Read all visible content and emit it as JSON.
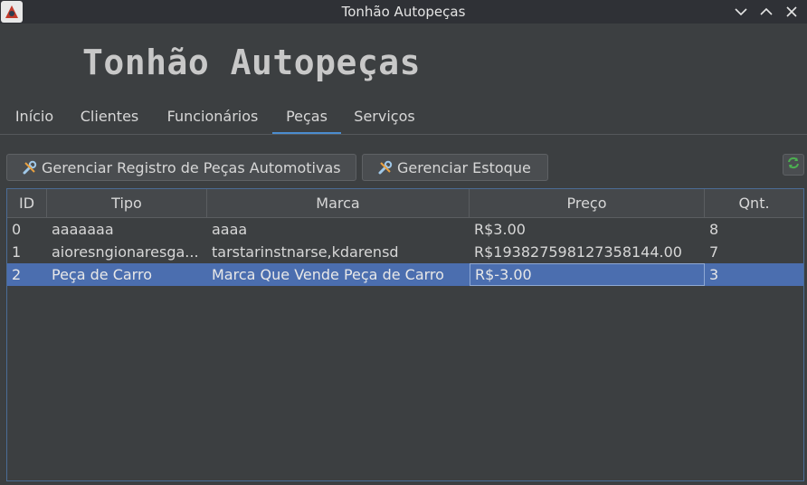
{
  "window": {
    "title": "Tonhão Autopeças"
  },
  "header": {
    "title": "Tonhão Autopeças"
  },
  "tabs": [
    {
      "label": "Início"
    },
    {
      "label": "Clientes"
    },
    {
      "label": "Funcionários"
    },
    {
      "label": "Peças",
      "active": true
    },
    {
      "label": "Serviços"
    }
  ],
  "toolbar": {
    "manage_registry_label": "Gerenciar Registro de Peças Automotivas",
    "manage_stock_label": "Gerenciar Estoque"
  },
  "table": {
    "columns": [
      "ID",
      "Tipo",
      "Marca",
      "Preço",
      "Qnt."
    ],
    "rows": [
      {
        "id": "0",
        "tipo": "aaaaaaa",
        "marca": "aaaa",
        "preco": "R$3.00",
        "qnt": "8"
      },
      {
        "id": "1",
        "tipo": "aioresngionaresga...",
        "marca": "tarstarinstnarse,kdarensd",
        "preco": "R$193827598127358144.00",
        "qnt": "7"
      },
      {
        "id": "2",
        "tipo": "Peça de Carro",
        "marca": "Marca Que Vende Peça de Carro",
        "preco": "R$-3.00",
        "qnt": "3",
        "selected": true
      }
    ]
  },
  "colors": {
    "accent": "#4b8ccf",
    "selection": "#4b6eaf",
    "background": "#3c3f41"
  }
}
